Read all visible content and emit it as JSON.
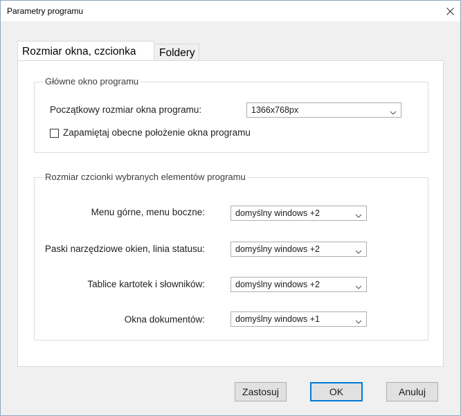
{
  "window": {
    "title": "Parametry programu"
  },
  "tabs": [
    {
      "label": "Rozmiar okna, czcionka",
      "active": true
    },
    {
      "label": "Foldery",
      "active": false
    }
  ],
  "group_main_window": {
    "title": "Główne okno programu",
    "initial_size_label": "Początkowy rozmiar okna programu:",
    "initial_size_value": "1366x768px",
    "remember_position_label": "Zapamiętaj obecne położenie okna programu",
    "remember_position_checked": false
  },
  "group_font_size": {
    "title": "Rozmiar czcionki wybranych elementów programu",
    "rows": [
      {
        "label": "Menu górne, menu boczne:",
        "value": "domyślny windows +2"
      },
      {
        "label": "Paski narzędziowe okien, linia statusu:",
        "value": "domyślny windows +2"
      },
      {
        "label": "Tablice kartotek i słowników:",
        "value": "domyślny windows +2"
      },
      {
        "label": "Okna dokumentów:",
        "value": "domyślny windows +1"
      }
    ]
  },
  "buttons": {
    "apply": "Zastosuj",
    "ok": "OK",
    "cancel": "Anuluj"
  },
  "icons": {
    "close": "close-icon",
    "dropdown": "chevron-down-icon"
  },
  "colors": {
    "accent": "#0078d7",
    "dialog_bg": "#f0f0f0",
    "panel_bg": "#ffffff"
  }
}
